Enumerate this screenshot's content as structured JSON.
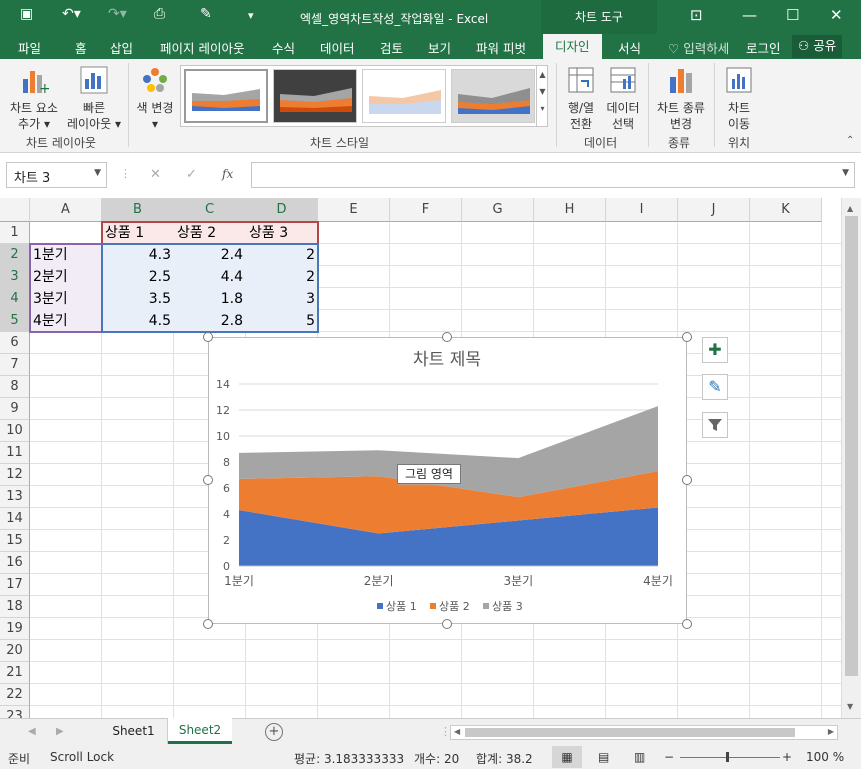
{
  "window": {
    "title": "엑셀_영역차트작성_작업화일 - Excel",
    "context_tab": "차트 도구"
  },
  "tabs": [
    "파일",
    "홈",
    "삽입",
    "페이지 레이아웃",
    "수식",
    "데이터",
    "검토",
    "보기",
    "파워 피벗",
    "디자인",
    "서식"
  ],
  "tell_me": "입력하세",
  "login": "로그인",
  "share": "공유",
  "ribbon": {
    "add_element": [
      "차트 요소",
      "추가"
    ],
    "quick_layout": [
      "빠른",
      "레이아웃"
    ],
    "change_color": "색 변경",
    "switch_row_col": [
      "행/열",
      "전환"
    ],
    "select_data": [
      "데이터",
      "선택"
    ],
    "change_type": [
      "차트 종류",
      "변경"
    ],
    "move_chart": [
      "차트",
      "이동"
    ],
    "groups": [
      "차트 레이아웃",
      "차트 스타일",
      "데이터",
      "종류",
      "위치"
    ]
  },
  "namebox": "차트 3",
  "formula_icons": {
    "cancel": "✕",
    "enter": "✓",
    "fx": "fx"
  },
  "columns": [
    "A",
    "B",
    "C",
    "D",
    "E",
    "F",
    "G",
    "H",
    "I",
    "J",
    "K"
  ],
  "rows": [
    "1",
    "2",
    "3",
    "4",
    "5",
    "6",
    "7",
    "8",
    "9",
    "10",
    "11",
    "12",
    "13",
    "14",
    "15",
    "16",
    "17",
    "18",
    "19",
    "20",
    "21",
    "22",
    "23"
  ],
  "table": {
    "headers": [
      "상품 1",
      "상품 2",
      "상품 3"
    ],
    "labels": [
      "1분기",
      "2분기",
      "3분기",
      "4분기"
    ],
    "values": [
      [
        "4.3",
        "2.4",
        "2"
      ],
      [
        "2.5",
        "4.4",
        "2"
      ],
      [
        "3.5",
        "1.8",
        "3"
      ],
      [
        "4.5",
        "2.8",
        "5"
      ]
    ]
  },
  "chart_data": {
    "type": "area",
    "stacked": true,
    "title": "차트 제목",
    "categories": [
      "1분기",
      "2분기",
      "3분기",
      "4분기"
    ],
    "series": [
      {
        "name": "상품 1",
        "values": [
          4.3,
          2.5,
          3.5,
          4.5
        ],
        "color": "#4472c4"
      },
      {
        "name": "상품 2",
        "values": [
          2.4,
          4.4,
          1.8,
          2.8
        ],
        "color": "#ed7d31"
      },
      {
        "name": "상품 3",
        "values": [
          2,
          2,
          3,
          5
        ],
        "color": "#a5a5a5"
      }
    ],
    "ylim": [
      0,
      14
    ],
    "yticks": [
      "0",
      "2",
      "4",
      "6",
      "8",
      "10",
      "12",
      "14"
    ],
    "grid": true,
    "legend": "bottom",
    "tooltip": "그림 영역"
  },
  "sheets": [
    "Sheet1",
    "Sheet2"
  ],
  "active_sheet": "Sheet2",
  "status": {
    "mode": "준비",
    "scroll_lock": "Scroll Lock",
    "average": "평균: 3.183333333",
    "count": "개수: 20",
    "sum": "합계: 38.2",
    "zoom": "100 %"
  }
}
